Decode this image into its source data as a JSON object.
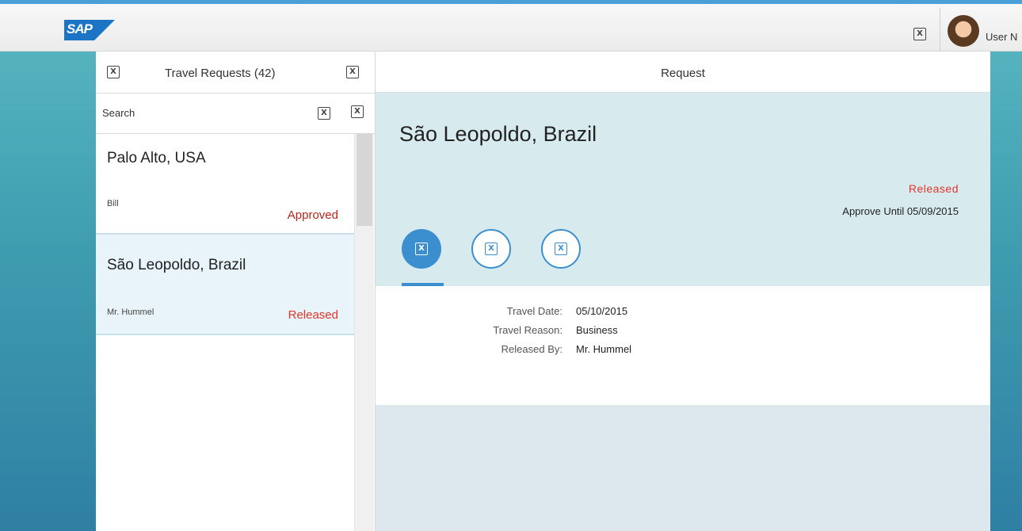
{
  "shell": {
    "logo_text": "SAP",
    "user_name": "User N",
    "icon": "placeholder-icon"
  },
  "master": {
    "title": "Travel Requests (42)",
    "search_placeholder": "Search",
    "items": [
      {
        "title": "Palo Alto, USA",
        "person": "Bill",
        "status": "Approved",
        "status_color": "#b5261e"
      },
      {
        "title": "São Leopoldo, Brazil",
        "person": "Mr. Hummel",
        "status": "Released",
        "status_color": "#e0362c"
      }
    ]
  },
  "detail": {
    "header_title": "Request",
    "object_title": "São Leopoldo, Brazil",
    "status": "Released",
    "approve_until": "Approve Until 05/09/2015",
    "fields": [
      {
        "label": "Travel Date:",
        "value": "05/10/2015"
      },
      {
        "label": "Travel Reason:",
        "value": "Business"
      },
      {
        "label": "Released By:",
        "value": "Mr. Hummel"
      }
    ]
  },
  "colors": {
    "accent": "#3c8fcf",
    "status_red": "#e0362c",
    "selected_bg": "#e8f4f9",
    "object_header_bg": "#d7ebef"
  }
}
